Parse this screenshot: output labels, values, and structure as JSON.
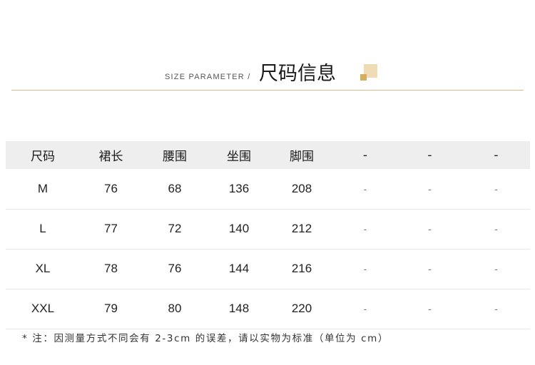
{
  "header": {
    "subtitle": "SIZE PARAMETER /",
    "title": "尺码信息"
  },
  "table": {
    "columns": [
      "尺码",
      "裙长",
      "腰围",
      "坐围",
      "脚围",
      "-",
      "-",
      "-"
    ],
    "rows": [
      [
        "M",
        "76",
        "68",
        "136",
        "208",
        "-",
        "-",
        "-"
      ],
      [
        "L",
        "77",
        "72",
        "140",
        "212",
        "-",
        "-",
        "-"
      ],
      [
        "XL",
        "78",
        "76",
        "144",
        "216",
        "-",
        "-",
        "-"
      ],
      [
        "XXL",
        "79",
        "80",
        "148",
        "220",
        "-",
        "-",
        "-"
      ]
    ]
  },
  "note": "* 注：因测量方式不同会有 2-3cm 的误差，请以实物为标准（单位为 cm）",
  "colors": {
    "accent_line": "#d9b98a",
    "deco_light": "#f0dcb4",
    "deco_dark": "#d6ad5e",
    "header_row_bg": "#eeeeee"
  }
}
